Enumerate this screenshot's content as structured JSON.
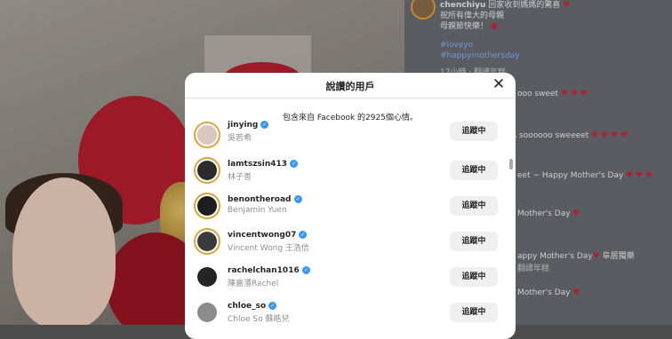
{
  "modal": {
    "title": "說讚的用戶",
    "subtitle": "包含來自 Facebook 的2925個心情。",
    "close_glyph": "✕"
  },
  "users": [
    {
      "username": "jinying",
      "fullname": "吳若希",
      "button": "追蹤中"
    },
    {
      "username": "lamtszsin413",
      "fullname": "林子善",
      "button": "追蹤中"
    },
    {
      "username": "benontheroad",
      "fullname": "Benjamin Yuen",
      "button": "追蹤中"
    },
    {
      "username": "vincentwong07",
      "fullname": "Vincent Wong 王浩信",
      "button": "追蹤中"
    },
    {
      "username": "rachelchan1016",
      "fullname": "陳嘉灃Rachel",
      "button": "追蹤中"
    },
    {
      "username": "chloe_so",
      "fullname": "Chloe So 蘇皓兒",
      "button": "追蹤中"
    }
  ],
  "background": {
    "post_author": "chenchiyu",
    "caption_line1": "回家收到媽媽的驚喜",
    "caption_line2": "祝所有偉大的母親",
    "caption_line3": "母親節快樂！",
    "tag1": "#loveyo",
    "tag2": "#happymothersday",
    "time": "17小時 · 翻譯年糕",
    "comment1": "ooo sweet",
    "comment2": "A soooooo sweeeet",
    "comment3": "eet ~ Happy Mother's Day",
    "comment4": "Mother's Day",
    "comment5": "appy Mother's Day",
    "comment5b": "阜居獨樂",
    "comment5c": "翻譯年糕",
    "comment6": "Mother's Day"
  }
}
